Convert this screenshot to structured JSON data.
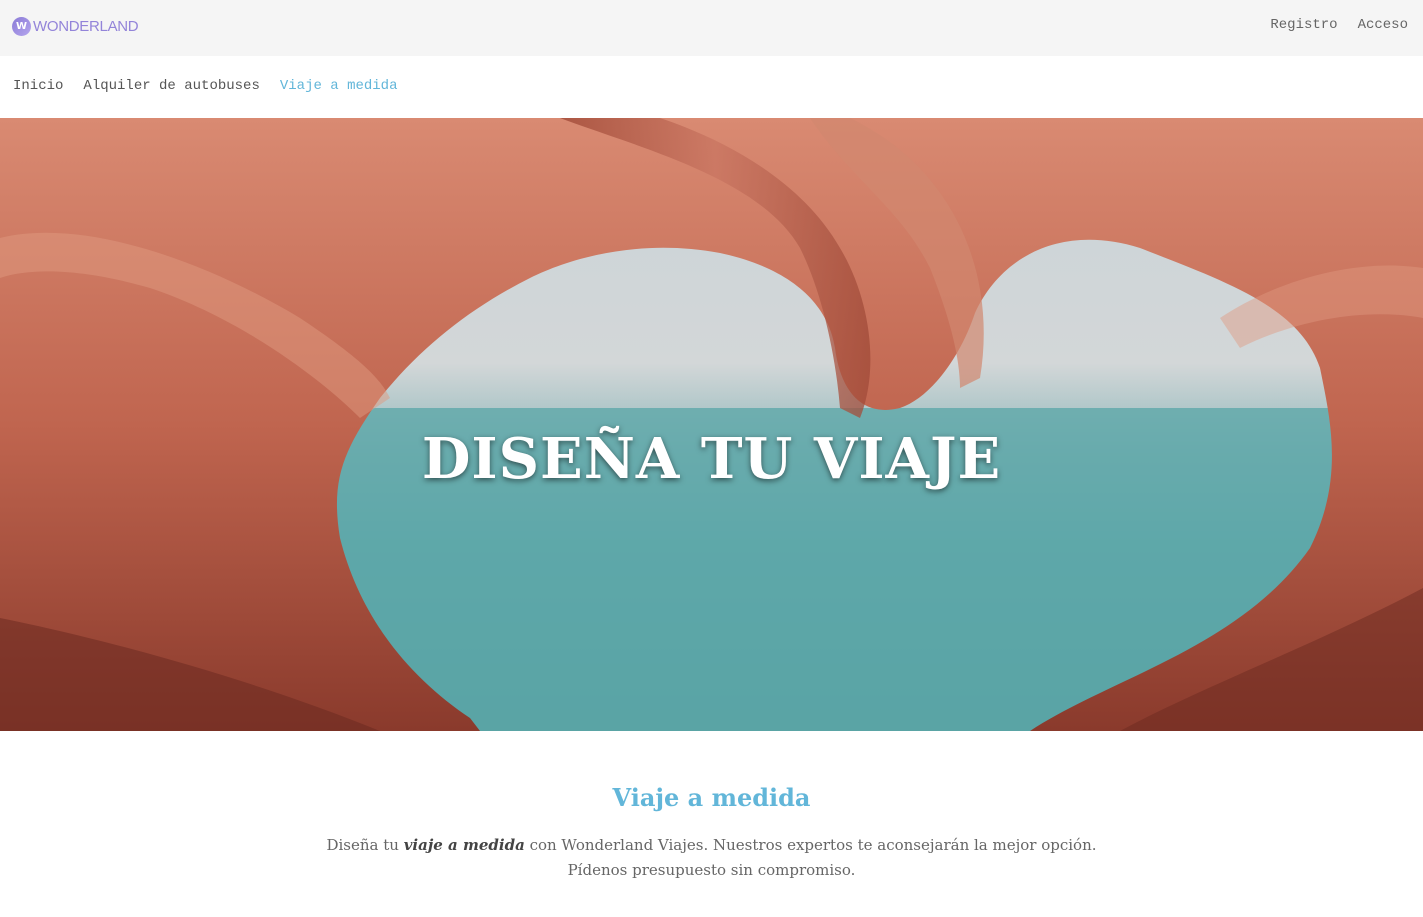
{
  "header": {
    "logo_text": "WONDERLAND",
    "logo_mark": "W",
    "links": {
      "register": "Registro",
      "login": "Acceso"
    }
  },
  "nav": {
    "items": [
      {
        "label": "Inicio",
        "active": false
      },
      {
        "label": "Alquiler de autobuses",
        "active": false
      },
      {
        "label": "Viaje a medida",
        "active": true
      }
    ]
  },
  "hero": {
    "title": "DISEÑA TU VIAJE",
    "image": "hands-heart-sea-photo"
  },
  "section": {
    "title": "Viaje a medida",
    "text_before": "Diseña tu ",
    "text_emphasis": "viaje a medida",
    "text_after": " con Wonderland Viajes. Nuestros expertos te aconsejarán la mejor opción.",
    "text_line2": "Pídenos presupuesto sin compromiso."
  },
  "colors": {
    "accent": "#62b6d9",
    "logo": "#9384d9",
    "topbar_bg": "#f5f5f5"
  }
}
